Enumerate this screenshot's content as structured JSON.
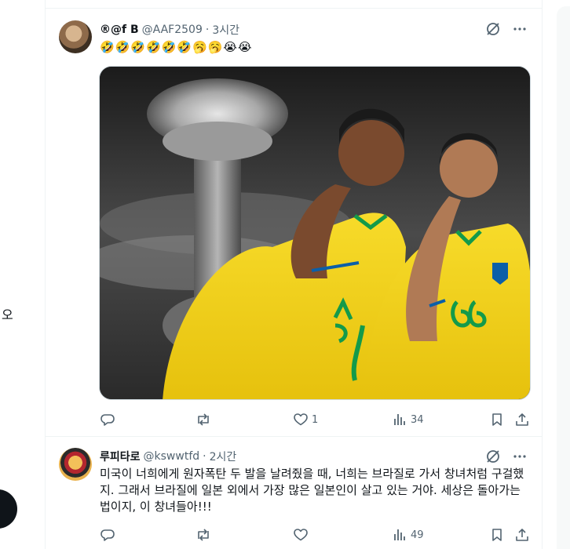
{
  "left_sidebar": {
    "partial_label": "오"
  },
  "posts": [
    {
      "author_name": "®@f B",
      "handle": "@AAF2509",
      "separator": "·",
      "time": "3시간",
      "text": "🤣🤣🤣🤣🤣🤣🥱🥱😭😭",
      "media": {
        "type": "photo",
        "description_icon": "photo-icon"
      },
      "stats": {
        "replies": "",
        "reposts": "",
        "likes": "1",
        "views": "34"
      }
    },
    {
      "author_name": "루피타로",
      "handle": "@kswwtfd",
      "separator": "·",
      "time": "2시간",
      "text": "미국이 너희에게 원자폭탄 두 발을 날려줬을 때, 너희는 브라질로 가서 창녀처럼 구걸했지. 그래서 브라질에 일본 외에서 가장 많은 일본인이 살고 있는 거야. 세상은 돌아가는 법이지, 이 창녀들아!!!",
      "stats": {
        "replies": "",
        "reposts": "",
        "likes": "",
        "views": "49"
      }
    }
  ],
  "colors": {
    "text_primary": "#0f1419",
    "text_secondary": "#536471",
    "border": "#eff3f4",
    "jersey_yellow": "#f5d619",
    "jersey_green": "#139a4a"
  }
}
